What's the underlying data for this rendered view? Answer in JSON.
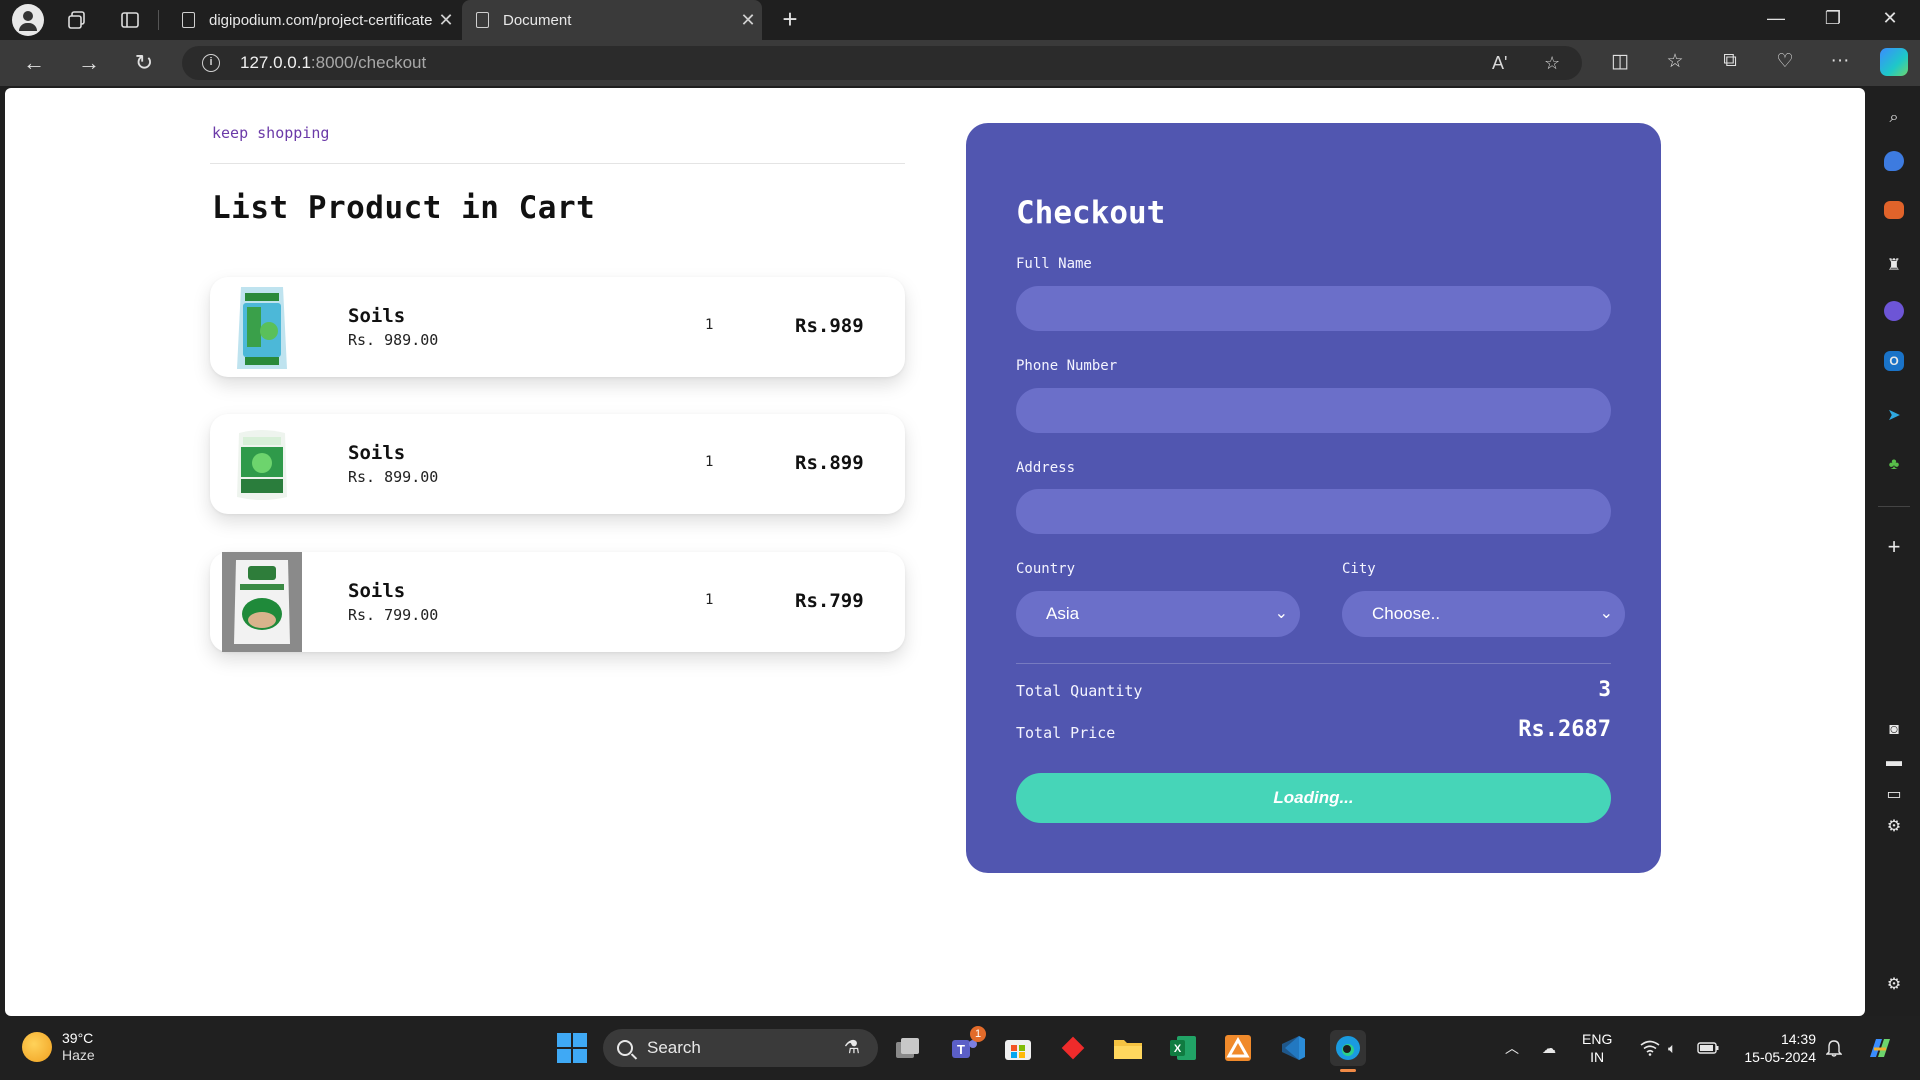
{
  "browser": {
    "tabs": [
      {
        "title": "digipodium.com/project-certificate",
        "active": false
      },
      {
        "title": "Document",
        "active": true
      }
    ],
    "url_host": "127.0.0.1",
    "url_rest": ":8000/checkout",
    "read_aloud_label": "Aʹ"
  },
  "cart": {
    "keep_shopping": "keep shopping",
    "title": "List Product in Cart",
    "items": [
      {
        "name": "Soils",
        "price": "Rs. 989.00",
        "qty": "1",
        "total": "Rs.989"
      },
      {
        "name": "Soils",
        "price": "Rs. 899.00",
        "qty": "1",
        "total": "Rs.899"
      },
      {
        "name": "Soils",
        "price": "Rs. 799.00",
        "qty": "1",
        "total": "Rs.799"
      }
    ]
  },
  "checkout": {
    "title": "Checkout",
    "full_name_label": "Full Name",
    "phone_label": "Phone Number",
    "address_label": "Address",
    "country_label": "Country",
    "country_value": "Asia",
    "city_label": "City",
    "city_value": "Choose..",
    "total_quantity_label": "Total Quantity",
    "total_quantity_value": "3",
    "total_price_label": "Total Price",
    "total_price_value": "Rs.2687",
    "button_label": "Loading..."
  },
  "taskbar": {
    "weather_temp": "39°C",
    "weather_cond": "Haze",
    "search_label": "Search",
    "teams_badge": "1",
    "lang_line1": "ENG",
    "lang_line2": "IN",
    "time": "14:39",
    "date": "15-05-2024"
  },
  "colors": {
    "checkout_panel": "#5156b0",
    "input_fill": "#6b6fc9",
    "button": "#46d5b8",
    "keep_shopping_link": "#6b3aa8"
  }
}
